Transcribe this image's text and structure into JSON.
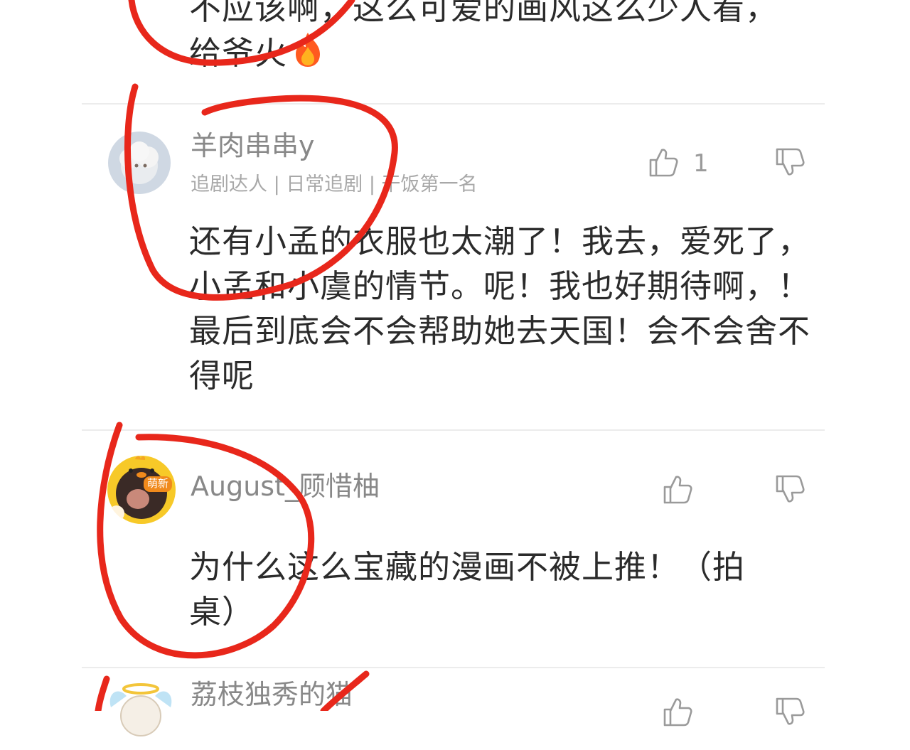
{
  "top_comment": {
    "text_line1": "不应该啊，这么可爱的画风这么少人看，",
    "text_line2": "给爷火",
    "emoji_icon": "fire-icon"
  },
  "comments": [
    {
      "username": "羊肉串串y",
      "badges": "追剧达人 | 日常追剧 | 干饭第一名",
      "like_count": "1",
      "text": "还有小孟的衣服也太潮了！我去，爱死了，小孟和小虞的情节。呢！我也好期待啊，！最后到底会不会帮助她去天国！会不会舍不得呢"
    },
    {
      "username": "August_顾惜柚",
      "avatar_tag": "萌新",
      "text": "为什么这么宝藏的漫画不被上推！（拍桌）"
    },
    {
      "username": "荔枝独秀的猫"
    }
  ],
  "colors": {
    "annotation_red": "#e8271b",
    "divider": "#ececec",
    "username": "#888888",
    "badge_text": "#a8a8a8",
    "icon_gray": "#9a9a9a"
  }
}
